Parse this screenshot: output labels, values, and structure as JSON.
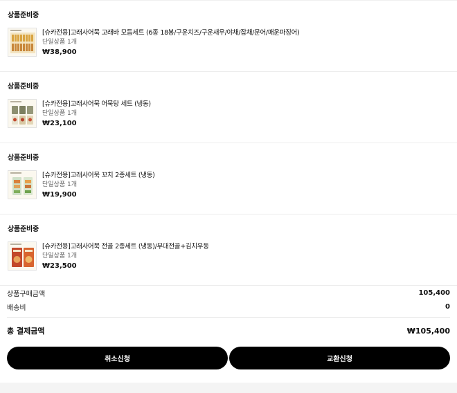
{
  "orders": [
    {
      "status": "상품준비중",
      "name": "[슈카전용]고래사어묵 고래바 모듬세트 (6종 18봉/구운치즈/구운새우/야채/잡채/문어/매운파징어)",
      "option": "단일상품 1개",
      "price": "₩38,900",
      "thumb_icon": "fishcake-bar-set-image"
    },
    {
      "status": "상품준비중",
      "name": "[슈카전용]고래사어묵 어묵탕 세트 (냉동)",
      "option": "단일상품 1개",
      "price": "₩23,100",
      "thumb_icon": "fishcake-soup-set-image"
    },
    {
      "status": "상품준비중",
      "name": "[슈카전용]고래사어묵 꼬치 2종세트 (냉동)",
      "option": "단일상품 1개",
      "price": "₩19,900",
      "thumb_icon": "fishcake-skewer-set-image"
    },
    {
      "status": "상품준비중",
      "name": "[슈카전용]고래사어묵 전골 2종세트 (냉동)/부대전골+김치우동",
      "option": "단일상품 1개",
      "price": "₩23,500",
      "thumb_icon": "fishcake-hotpot-set-image"
    }
  ],
  "summary": {
    "product_total_label": "상품구매금액",
    "product_total_value": "105,400",
    "shipping_label": "배송비",
    "shipping_value": "0",
    "grand_total_label": "총 결제금액",
    "grand_total_value": "₩105,400"
  },
  "buttons": {
    "cancel": "취소신청",
    "exchange": "교환신청"
  },
  "colors": {
    "button_bg": "#000000",
    "button_text": "#ffffff",
    "page_bg": "#f4f4f4"
  }
}
